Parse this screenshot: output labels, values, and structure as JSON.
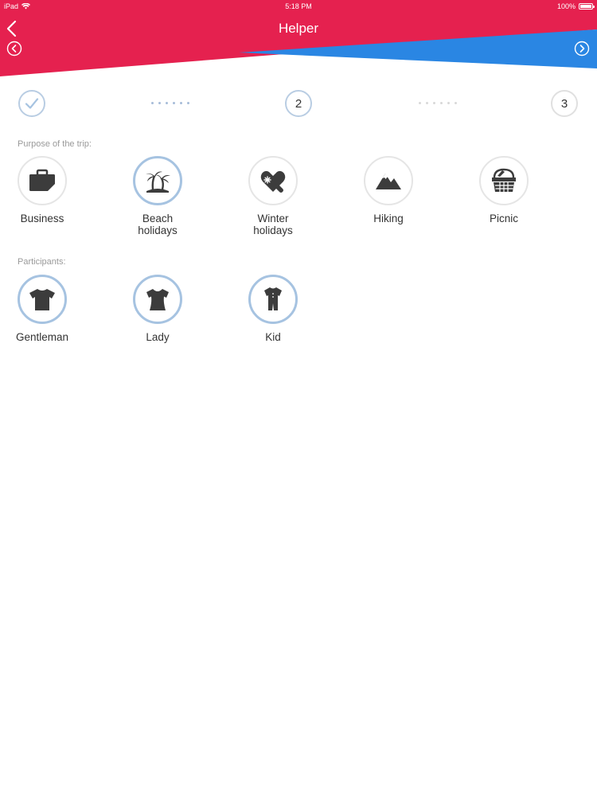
{
  "statusbar": {
    "device": "iPad",
    "time": "5:18 PM",
    "battery": "100%"
  },
  "header": {
    "title": "Helper",
    "colors": {
      "red": "#e5214f",
      "blue": "#2a86e3"
    }
  },
  "stepper": {
    "steps": [
      {
        "label": "",
        "state": "done"
      },
      {
        "label": "2",
        "state": "current"
      },
      {
        "label": "3",
        "state": "upcoming"
      }
    ]
  },
  "purpose": {
    "label": "Purpose of the trip:",
    "options": [
      {
        "label": "Business",
        "icon": "briefcase-icon",
        "selected": false
      },
      {
        "label": "Beach\nholidays",
        "icon": "palm-tree-icon",
        "selected": true
      },
      {
        "label": "Winter\nholidays",
        "icon": "mitten-icon",
        "selected": false
      },
      {
        "label": "Hiking",
        "icon": "mountain-icon",
        "selected": false
      },
      {
        "label": "Picnic",
        "icon": "picnic-basket-icon",
        "selected": false
      }
    ]
  },
  "participants": {
    "label": "Participants:",
    "options": [
      {
        "label": "Gentleman",
        "icon": "tshirt-icon",
        "selected": true
      },
      {
        "label": "Lady",
        "icon": "blouse-icon",
        "selected": true
      },
      {
        "label": "Kid",
        "icon": "onesie-icon",
        "selected": true
      }
    ]
  }
}
